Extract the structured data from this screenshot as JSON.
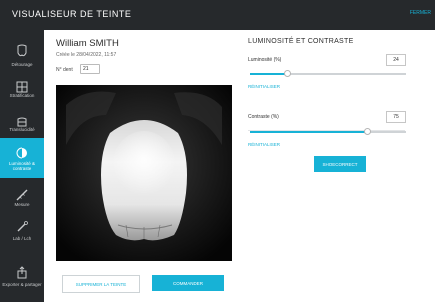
{
  "app": {
    "title": "VISUALISEUR DE TEINTE",
    "top_link": "FERMER"
  },
  "sidebar": {
    "items": [
      {
        "label": "Détourage",
        "icon": "tooth-outline-icon",
        "active": false
      },
      {
        "label": "Stratification",
        "icon": "layers-icon",
        "active": false
      },
      {
        "label": "Translucidité",
        "icon": "translucency-icon",
        "active": false
      },
      {
        "label": "Luminosité & contraste",
        "icon": "brightness-icon",
        "active": true
      },
      {
        "label": "Mesure",
        "icon": "ruler-icon",
        "active": false
      },
      {
        "label": "Lab / Lch",
        "icon": "pipette-icon",
        "active": false
      },
      {
        "label": "Exporter & partager",
        "icon": "share-icon",
        "active": false
      }
    ]
  },
  "patient": {
    "name": "William SMITH",
    "created": "Créée le 28/04/2022, 11:57",
    "tooth_label": "N° dent",
    "tooth_number": "21"
  },
  "actions": {
    "delete_label": "SUPPRIMER LA TEINTE",
    "order_label": "COMMANDER"
  },
  "panel": {
    "title": "LUMINOSITÉ ET CONTRASTE",
    "brightness": {
      "label": "Luminosité (%)",
      "value": "24",
      "fraction": 0.24,
      "reset_label": "RÉINITIALISER"
    },
    "contrast": {
      "label": "Contraste (%)",
      "value": "75",
      "fraction": 0.75,
      "reset_label": "RÉINITIALISER"
    },
    "correct_label": "SHOECORRECT"
  },
  "colors": {
    "accent": "#17b2d6",
    "dark": "#26292c"
  }
}
